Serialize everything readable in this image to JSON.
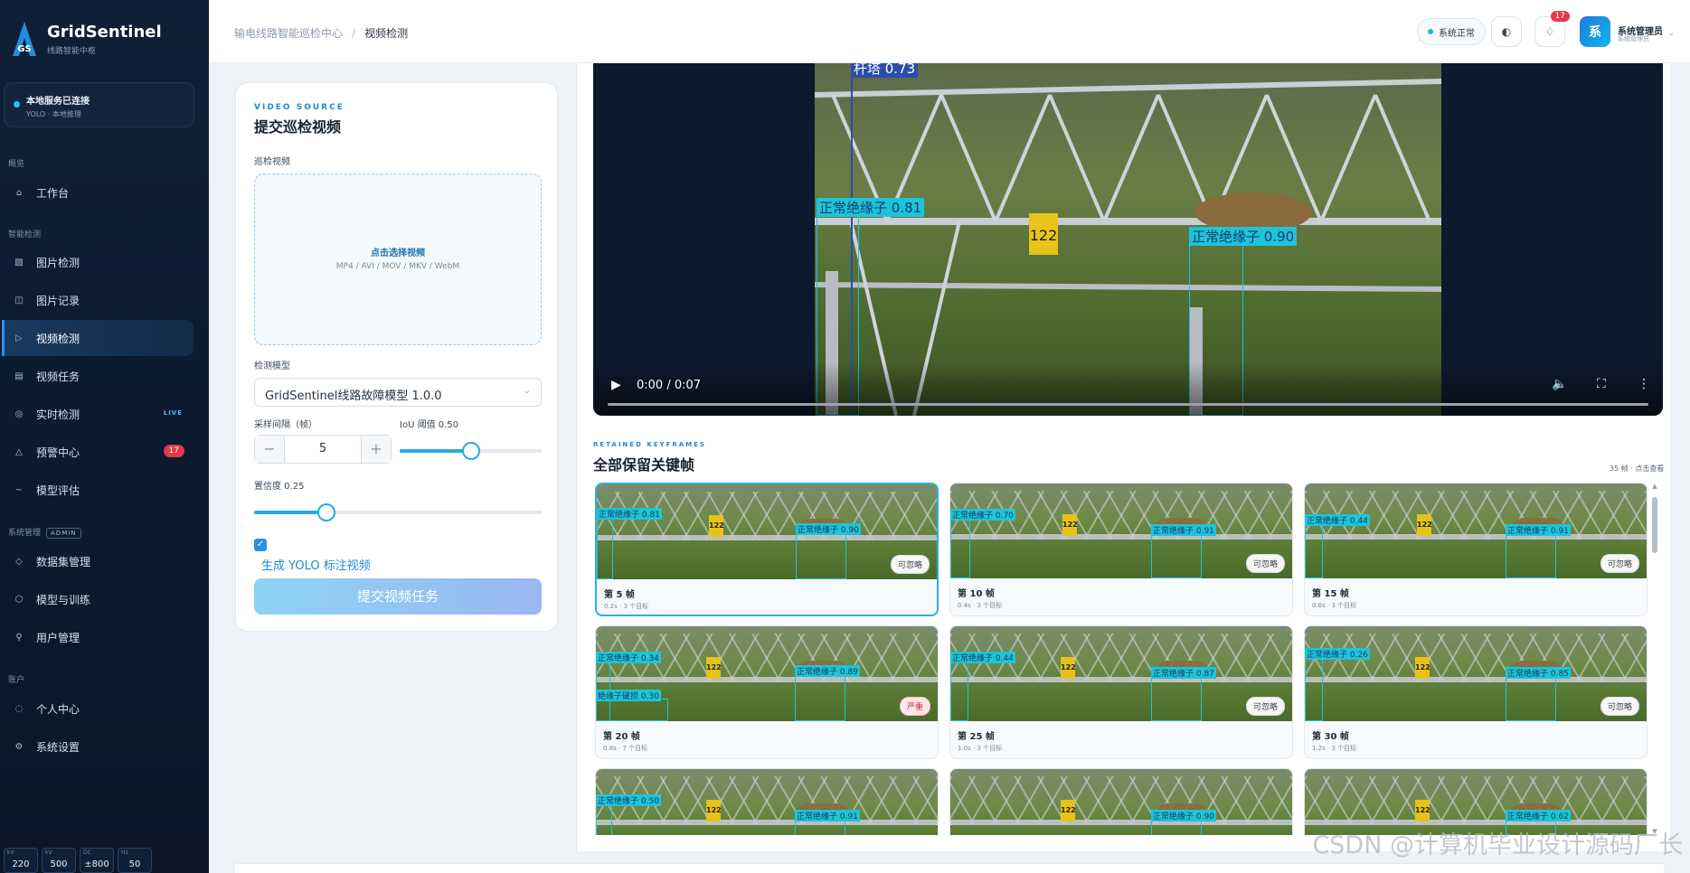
{
  "brand": {
    "title": "GridSentinel",
    "subtitle": "线路智能中枢",
    "logo_text": "GS"
  },
  "service": {
    "title": "本地服务已连接",
    "subtitle": "YOLO · 本地推理"
  },
  "sidebar": {
    "section_overview": "概览",
    "section_detect": "智能检测",
    "section_admin": "系统管理",
    "admin_tag": "ADMIN",
    "section_account": "账户",
    "items": [
      {
        "label": "工作台",
        "icon": "home-icon"
      },
      {
        "label": "图片检测",
        "icon": "image-icon"
      },
      {
        "label": "图片记录",
        "icon": "record-icon"
      },
      {
        "label": "视频检测",
        "icon": "play-icon",
        "active": true
      },
      {
        "label": "视频任务",
        "icon": "list-icon"
      },
      {
        "label": "实时检测",
        "icon": "target-icon",
        "tag": "LIVE"
      },
      {
        "label": "预警中心",
        "icon": "alert-icon",
        "badge": "17"
      },
      {
        "label": "模型评估",
        "icon": "trend-icon"
      },
      {
        "label": "数据集管理",
        "icon": "dataset-icon"
      },
      {
        "label": "模型与训练",
        "icon": "hexagon-icon"
      },
      {
        "label": "用户管理",
        "icon": "user-icon"
      },
      {
        "label": "个人中心",
        "icon": "profile-icon"
      },
      {
        "label": "系统设置",
        "icon": "gear-icon"
      }
    ],
    "stats": [
      {
        "k": "kV",
        "v": "220"
      },
      {
        "k": "kV",
        "v": "500"
      },
      {
        "k": "DC",
        "v": "±800"
      },
      {
        "k": "Hz",
        "v": "50"
      }
    ]
  },
  "topbar": {
    "breadcrumb_root": "输电线路智能巡检中心",
    "breadcrumb_sep": "/",
    "breadcrumb_current": "视频检测",
    "status": "系统正常",
    "notifications": "17",
    "avatar_char": "系",
    "user_name": "系统管理员",
    "user_role": "系统管理员"
  },
  "form": {
    "eyebrow": "VIDEO SOURCE",
    "title": "提交巡检视频",
    "video_label": "巡检视频",
    "dropzone_title": "点击选择视频",
    "dropzone_formats": "MP4 / AVI / MOV / MKV / WebM",
    "model_label": "检测模型",
    "model_value": "GridSentinel线路故障模型 1.0.0",
    "interval_label": "采样间隔（帧）",
    "interval_value": "5",
    "iou_label": "IoU 阈值 0.50",
    "iou_value": 0.5,
    "conf_label": "置信度 0.25",
    "conf_value": 0.25,
    "checkbox_label": "生成 YOLO 标注视频",
    "checkbox_checked": true,
    "submit_label": "提交视频任务"
  },
  "video": {
    "time": "0:00 / 0:07",
    "detections": [
      {
        "label": "杆塔 0.73",
        "type": "tower"
      },
      {
        "label": "正常绝缘子 0.81",
        "type": "insulator"
      },
      {
        "label": "正常绝缘子 0.90",
        "type": "insulator"
      }
    ],
    "plate_text": "122"
  },
  "keyframes": {
    "eyebrow": "RETAINED KEYFRAMES",
    "title": "全部保留关键帧",
    "meta": "35 帧 · 点击查看",
    "items": [
      {
        "name": "第 5 帧",
        "sub": "0.2s · 3 个目标",
        "status": "可忽略",
        "labels": [
          "正常绝缘子 0.81",
          "正常绝缘子 0.90"
        ]
      },
      {
        "name": "第 10 帧",
        "sub": "0.4s · 3 个目标",
        "status": "可忽略",
        "labels": [
          "正常绝缘子 0.70",
          "正常绝缘子 0.91"
        ]
      },
      {
        "name": "第 15 帧",
        "sub": "0.6s · 3 个目标",
        "status": "可忽略",
        "labels": [
          "正常绝缘子 0.44",
          "正常绝缘子 0.91"
        ]
      },
      {
        "name": "第 20 帧",
        "sub": "0.8s · 7 个目标",
        "status": "严重",
        "labels": [
          "正常绝缘子 0.34",
          "正常绝缘子 0.89",
          "绝缘子破损 0.30"
        ]
      },
      {
        "name": "第 25 帧",
        "sub": "1.0s · 3 个目标",
        "status": "可忽略",
        "labels": [
          "正常绝缘子 0.44",
          "正常绝缘子 0.87"
        ]
      },
      {
        "name": "第 30 帧",
        "sub": "1.2s · 3 个目标",
        "status": "可忽略",
        "labels": [
          "正常绝缘子 0.26",
          "正常绝缘子 0.85"
        ]
      },
      {
        "name": "",
        "sub": "",
        "status": "",
        "labels": [
          "正常绝缘子 0.50",
          "正常绝缘子 0.91"
        ]
      },
      {
        "name": "",
        "sub": "",
        "status": "",
        "labels": [
          "正常绝缘子 0.90"
        ]
      },
      {
        "name": "",
        "sub": "",
        "status": "",
        "labels": [
          "正常绝缘子 0.62"
        ]
      }
    ]
  },
  "watermark": "CSDN @计算机毕业设计源码厂长"
}
